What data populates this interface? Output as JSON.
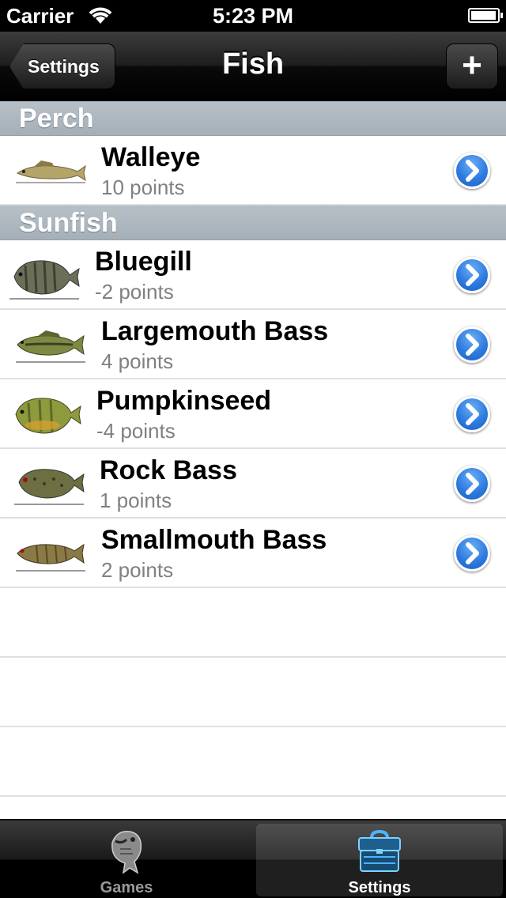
{
  "status_bar": {
    "carrier": "Carrier",
    "time": "5:23 PM"
  },
  "nav": {
    "title": "Fish",
    "back_label": "Settings",
    "add_label": "+"
  },
  "sections": [
    {
      "title": "Perch",
      "rows": [
        {
          "name": "Walleye",
          "points": "10 points",
          "body_color": "#b5a46a",
          "icon": "walleye-thumbnail"
        }
      ]
    },
    {
      "title": "Sunfish",
      "rows": [
        {
          "name": "Bluegill",
          "points": "-2 points",
          "body_color": "#6b6f58",
          "icon": "bluegill-thumbnail"
        },
        {
          "name": "Largemouth Bass",
          "points": "4 points",
          "body_color": "#7e8a43",
          "icon": "largemouth-bass-thumbnail"
        },
        {
          "name": "Pumpkinseed",
          "points": "-4 points",
          "body_color": "#8f9a3c",
          "icon": "pumpkinseed-thumbnail"
        },
        {
          "name": "Rock Bass",
          "points": "1 points",
          "body_color": "#6d6e42",
          "icon": "rock-bass-thumbnail"
        },
        {
          "name": "Smallmouth Bass",
          "points": "2 points",
          "body_color": "#8a7a45",
          "icon": "smallmouth-bass-thumbnail"
        }
      ]
    }
  ],
  "tabs": [
    {
      "label": "Games",
      "icon": "fish-icon",
      "selected": false
    },
    {
      "label": "Settings",
      "icon": "tackle-box-icon",
      "selected": true
    }
  ],
  "colors": {
    "section_header": "#abb5bd",
    "disclosure_blue": "#2e7be0",
    "selected_tab_icon": "#4fb3ff"
  }
}
